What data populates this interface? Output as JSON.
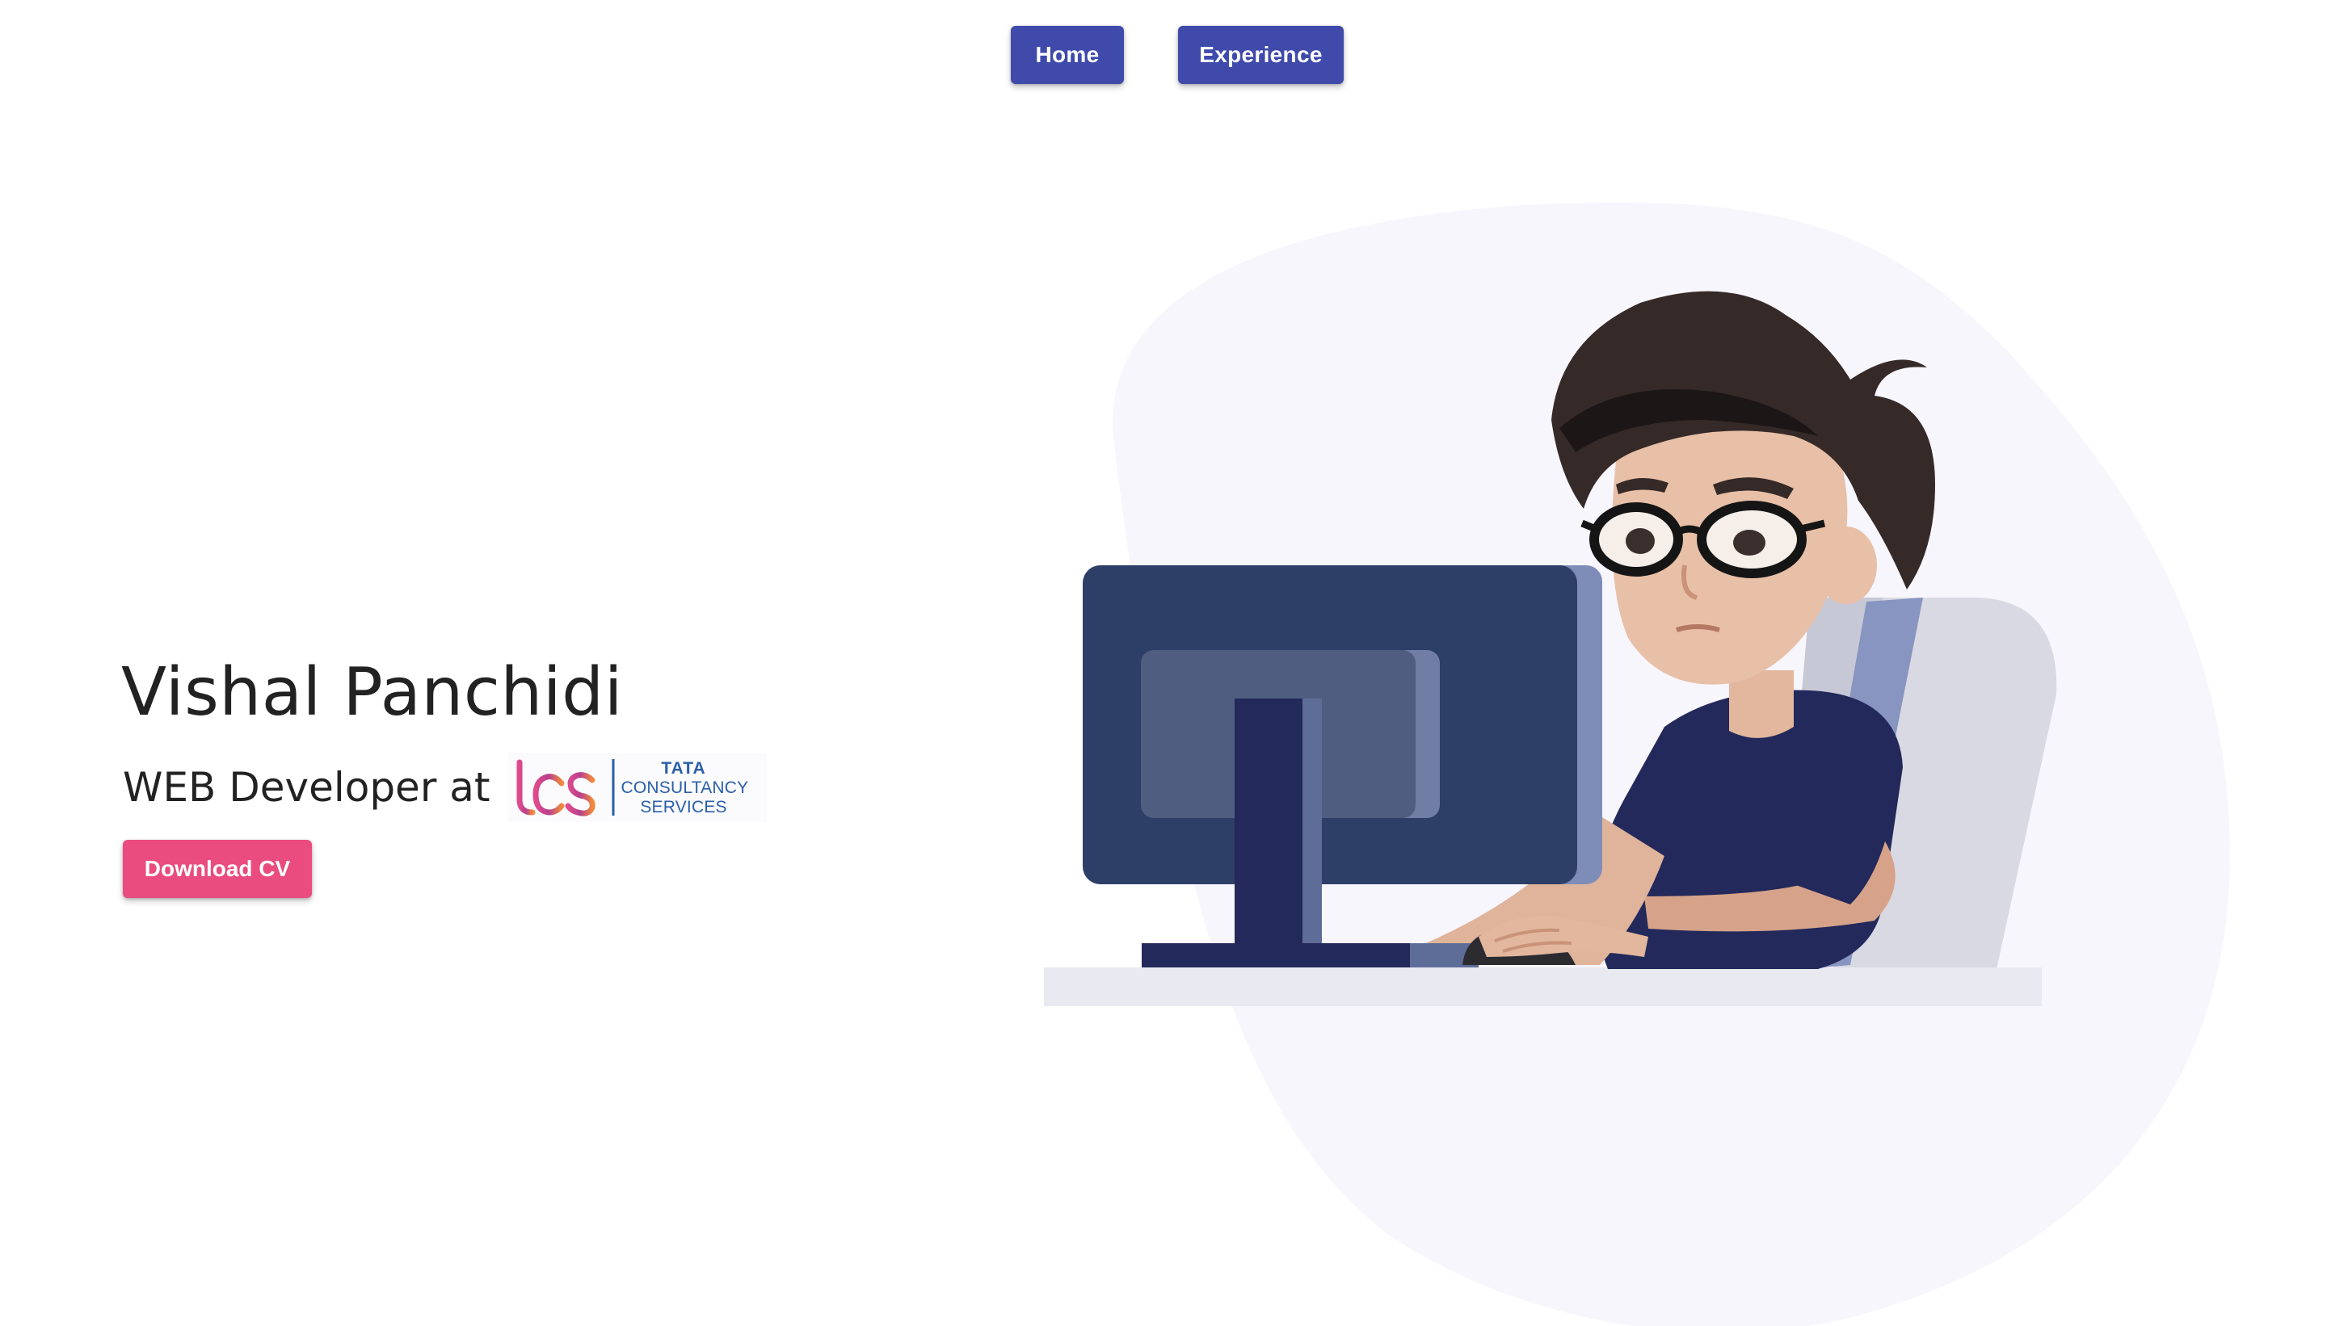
{
  "nav": {
    "home_label": "Home",
    "experience_label": "Experience"
  },
  "hero": {
    "name": "Vishal Panchidi",
    "role_prefix": "WEB Developer at",
    "company_logo": {
      "mark": "tcs",
      "line1": "TATA",
      "line2": "CONSULTANCY",
      "line3": "SERVICES"
    },
    "download_label": "Download CV"
  },
  "colors": {
    "nav_button": "#3f4aab",
    "download_button": "#ea4c7f",
    "blob": "#f8f6fd",
    "monitor": "#2d3f66",
    "shirt": "#23295a",
    "chair": "#d9d9e3"
  },
  "illustration": {
    "icon": "developer-at-computer-illustration"
  }
}
